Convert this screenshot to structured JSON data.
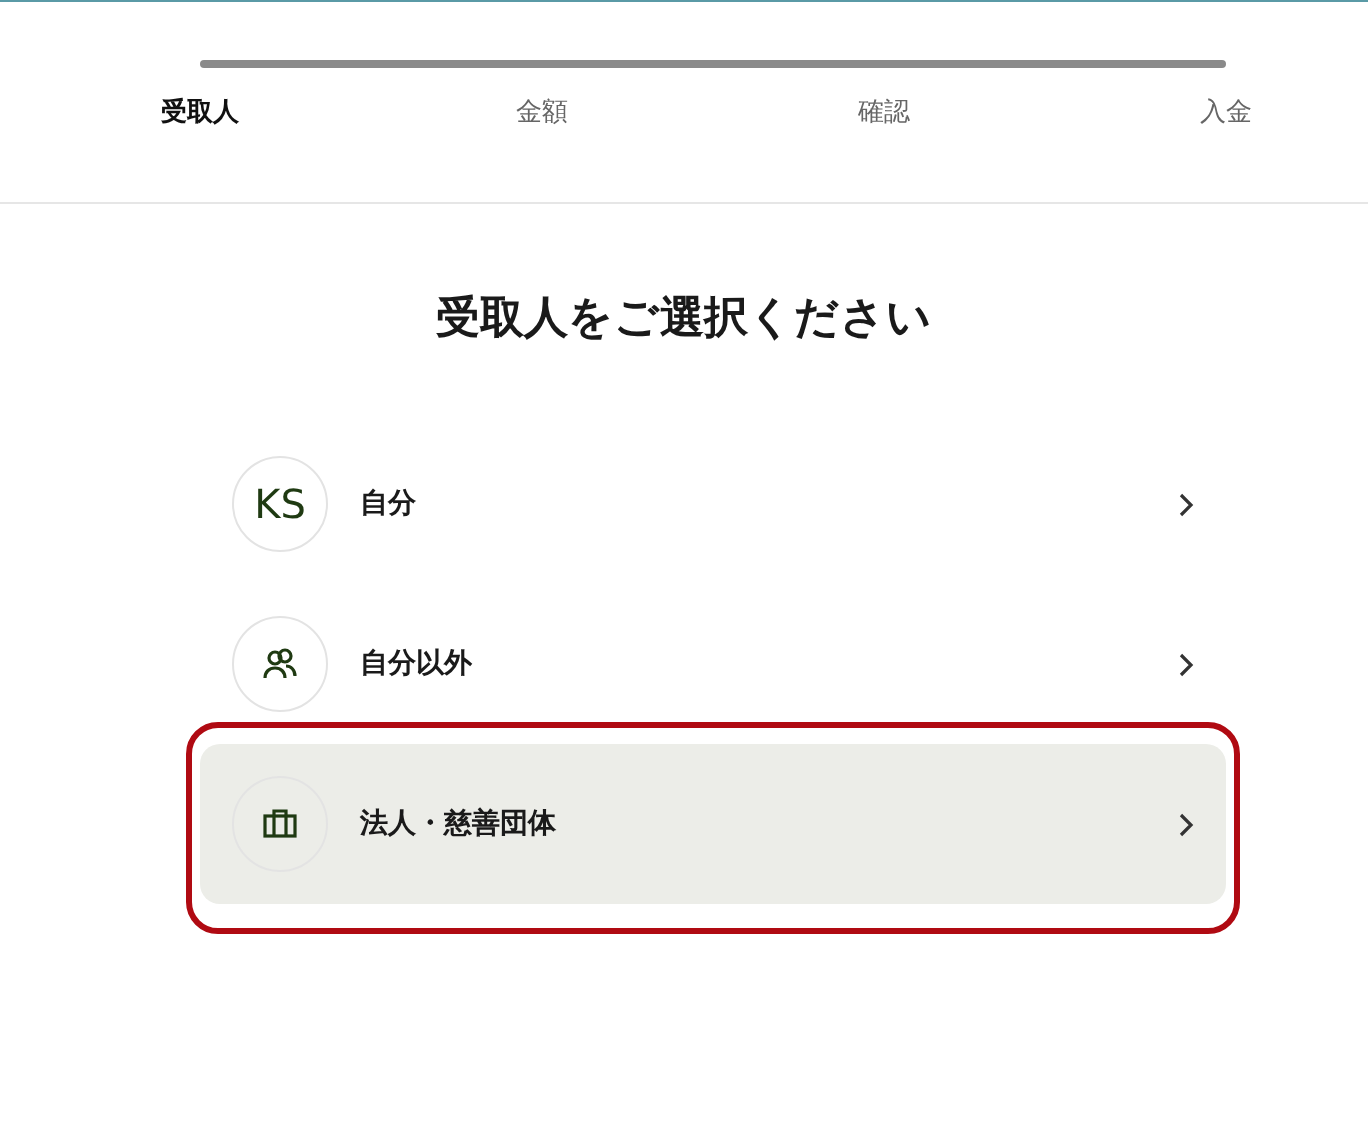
{
  "steps": [
    {
      "label": "受取人",
      "selected": true
    },
    {
      "label": "金額",
      "selected": false
    },
    {
      "label": "確認",
      "selected": false
    },
    {
      "label": "入金",
      "selected": false
    }
  ],
  "heading": "受取人をご選択ください",
  "recipients": [
    {
      "kind": "initials",
      "initials": "KS",
      "label": "自分",
      "selected": false
    },
    {
      "kind": "people",
      "label": "自分以外",
      "selected": false
    },
    {
      "kind": "briefcase",
      "label": "法人・慈善団体",
      "selected": true
    }
  ]
}
